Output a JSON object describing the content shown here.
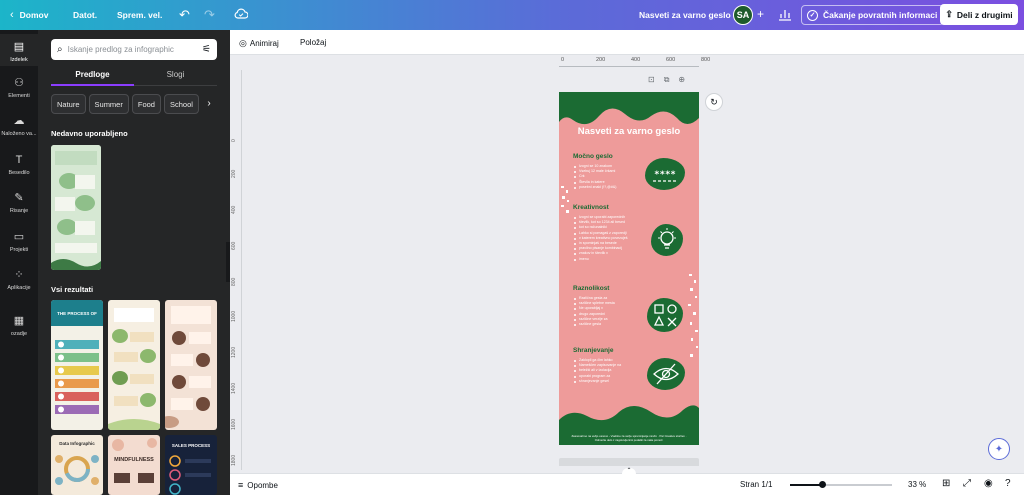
{
  "topbar": {
    "home_label": "Domov",
    "file_label": "Datot.",
    "resize_label": "Sprem. vel.",
    "design_title": "Nasveti za varno geslo",
    "avatar_initials": "SA",
    "feedback_label": "Čakanje povratnih informaci",
    "share_label": "Deli z drugimi"
  },
  "rail": {
    "items": [
      {
        "label": "Izdelek",
        "icon": "layout-icon"
      },
      {
        "label": "Elementi",
        "icon": "shapes-icon"
      },
      {
        "label": "Naloženo va...",
        "icon": "upload-icon"
      },
      {
        "label": "Besedilo",
        "icon": "text-icon"
      },
      {
        "label": "Risanje",
        "icon": "draw-icon"
      },
      {
        "label": "Projekti",
        "icon": "folder-icon"
      },
      {
        "label": "Aplikacije",
        "icon": "apps-icon"
      },
      {
        "label": "ozadje",
        "icon": "background-icon"
      }
    ]
  },
  "panel": {
    "search_placeholder": "Iskanje predlog za infographic",
    "tabs": [
      "Predloge",
      "Slogi"
    ],
    "chips": [
      "Nature",
      "Summer",
      "Food",
      "School",
      "Mi"
    ],
    "recent_title": "Nedavno uporabljeno",
    "results_title": "Vsi rezultati",
    "result_titles": [
      "THE PROCESS OF",
      "",
      "",
      "Data Infographic",
      "MINDFULNESS",
      "SALES PROCESS"
    ]
  },
  "toolbar": {
    "animate_label": "Animiraj",
    "position_label": "Položaj"
  },
  "ruler": {
    "h_ticks": [
      "0",
      "200",
      "400",
      "600",
      "800"
    ],
    "v_ticks": [
      "0",
      "200",
      "400",
      "600",
      "800",
      "1000",
      "1200",
      "1400",
      "1600",
      "1800",
      "2000"
    ]
  },
  "infographic": {
    "title": "Nasveti za varno geslo",
    "sections": [
      {
        "heading": "Močno geslo",
        "bullets": [
          "Izogni se 10 znakom",
          "Vsebuj 12 male črkami",
          "Crk",
          "Števila in katere",
          "posebni znaki (!?,@#&)"
        ]
      },
      {
        "heading": "Kreativnost",
        "bullets": [
          "Izogni se uporabi zaporednih",
          "številk, kot so 1234 ali besed",
          "kot so računalniki",
          "Lahko si pomagaš z zaporedji",
          "v katerem kreativno povezuješ",
          "in spominjaš na besede",
          "pravilno pisanje kombinacij",
          "znakov in številk v",
          "imenu"
        ]
      },
      {
        "heading": "Raznolikost",
        "bullets": [
          "Različna gesla za",
          "različne spletne mesta",
          "Ne uporabljaj v",
          "drugo zaporedni",
          "različne verzije za",
          "različne gesla"
        ]
      },
      {
        "heading": "Shranjevanje",
        "bullets": [
          "Zaklopli ga čim lahko",
          "Nameščen zapisovanje na",
          "beležki ali v izolacija",
          "uporabi program za",
          "shranjevanje gesel"
        ]
      }
    ],
    "footer": "Zasnovali so na večjo osnovo - Vsebine za večje spreminjanje mrežo · Par Creative storitev · Odmerite delo z zagotovljenimi podatki za naše pomoč."
  },
  "status": {
    "notes_label": "Opombe",
    "pages_label": "Stran 1/1",
    "zoom_label": "33 %",
    "zoom_fraction": 0.33
  },
  "colors": {
    "accent": "#8b3dff",
    "infographic_bg": "#ee9b9a",
    "infographic_green": "#1b6b33"
  }
}
